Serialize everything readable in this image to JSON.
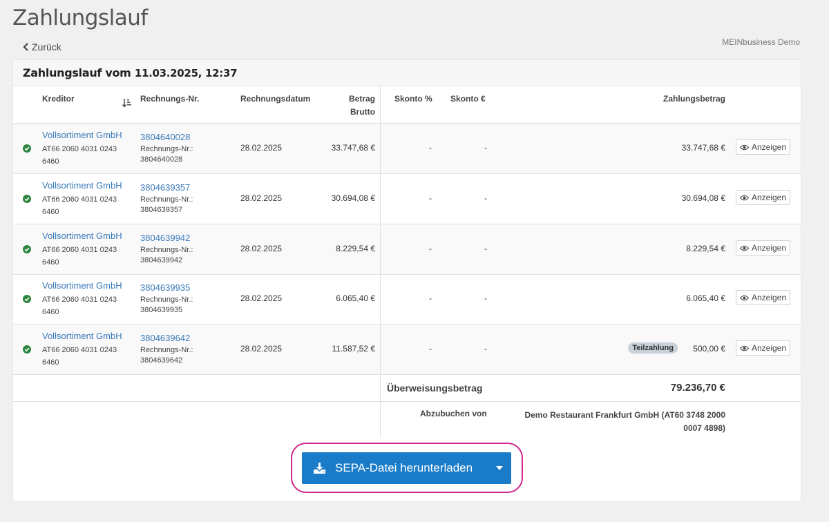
{
  "page": {
    "title": "Zahlungslauf",
    "back_label": "Zurück",
    "company": "MEINbusiness Demo"
  },
  "card": {
    "title_prefix": "Zahlungslauf vom",
    "title_date": "11.03.2025, 12:37"
  },
  "columns": {
    "kreditor": "Kreditor",
    "rechnungs_nr": "Rechnungs-Nr.",
    "rechnungsdatum": "Rechnungsdatum",
    "betrag_line1": "Betrag",
    "betrag_line2": "Brutto",
    "skonto_pct": "Skonto %",
    "skonto_eur": "Skonto €",
    "zahlungsbetrag": "Zahlungsbetrag"
  },
  "rows": [
    {
      "kreditor": "Vollsortiment GmbH",
      "iban": "AT66 2060 4031 0243 6460",
      "invoice": "3804640028",
      "invoice_sub_label": "Rechnungs-Nr.:",
      "invoice_sub": "3804640028",
      "date": "28.02.2025",
      "brutto": "33.747,68 €",
      "skonto_pct": "-",
      "skonto_eur": "-",
      "badge": "",
      "amount": "33.747,68 €",
      "view_label": "Anzeigen"
    },
    {
      "kreditor": "Vollsortiment GmbH",
      "iban": "AT66 2060 4031 0243 6460",
      "invoice": "3804639357",
      "invoice_sub_label": "Rechnungs-Nr.:",
      "invoice_sub": "3804639357",
      "date": "28.02.2025",
      "brutto": "30.694,08 €",
      "skonto_pct": "-",
      "skonto_eur": "-",
      "badge": "",
      "amount": "30.694,08 €",
      "view_label": "Anzeigen"
    },
    {
      "kreditor": "Vollsortiment GmbH",
      "iban": "AT66 2060 4031 0243 6460",
      "invoice": "3804639942",
      "invoice_sub_label": "Rechnungs-Nr.:",
      "invoice_sub": "3804639942",
      "date": "28.02.2025",
      "brutto": "8.229,54 €",
      "skonto_pct": "-",
      "skonto_eur": "-",
      "badge": "",
      "amount": "8.229,54 €",
      "view_label": "Anzeigen"
    },
    {
      "kreditor": "Vollsortiment GmbH",
      "iban": "AT66 2060 4031 0243 6460",
      "invoice": "3804639935",
      "invoice_sub_label": "Rechnungs-Nr.:",
      "invoice_sub": "3804639935",
      "date": "28.02.2025",
      "brutto": "6.065,40 €",
      "skonto_pct": "-",
      "skonto_eur": "-",
      "badge": "",
      "amount": "6.065,40 €",
      "view_label": "Anzeigen"
    },
    {
      "kreditor": "Vollsortiment GmbH",
      "iban": "AT66 2060 4031 0243 6460",
      "invoice": "3804639642",
      "invoice_sub_label": "Rechnungs-Nr.:",
      "invoice_sub": "3804639642",
      "date": "28.02.2025",
      "brutto": "11.587,52 €",
      "skonto_pct": "-",
      "skonto_eur": "-",
      "badge": "Teilzahlung",
      "amount": "500,00 €",
      "view_label": "Anzeigen"
    }
  ],
  "summary": {
    "label": "Überweisungsbetrag",
    "value": "79.236,70 €"
  },
  "debit": {
    "label": "Abzubuchen von",
    "value": "Demo Restaurant Frankfurt GmbH (AT60 3748 2000 0007 4898)"
  },
  "sepa_button": {
    "label": "SEPA-Datei herunterladen"
  },
  "icons": {
    "back": "chevron-left-icon",
    "sort": "sort-amount-icon",
    "status": "check-circle-icon",
    "view": "eye-icon",
    "download": "download-icon",
    "caret": "caret-down-icon"
  },
  "colors": {
    "link": "#3a7ab9",
    "primary_button": "#1a7cc9",
    "highlight": "#d0268e",
    "success": "#2e8540",
    "badge_bg": "#c8d0d8"
  }
}
